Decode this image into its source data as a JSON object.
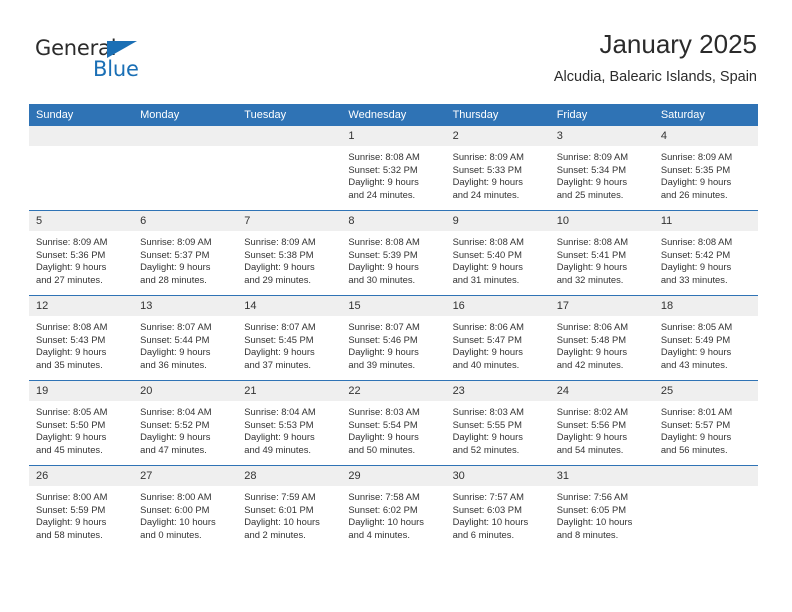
{
  "brand": {
    "name_part1": "General",
    "name_part2": "Blue",
    "accent_color": "#1a6fb5"
  },
  "header": {
    "title": "January 2025",
    "subtitle": "Alcudia, Balearic Islands, Spain"
  },
  "theme": {
    "header_row_color": "#2f73b5",
    "daynum_band_color": "#efefef",
    "text_color": "#333333"
  },
  "weekdays": [
    "Sunday",
    "Monday",
    "Tuesday",
    "Wednesday",
    "Thursday",
    "Friday",
    "Saturday"
  ],
  "weeks": [
    [
      {
        "day": "",
        "empty": true
      },
      {
        "day": "",
        "empty": true
      },
      {
        "day": "",
        "empty": true
      },
      {
        "day": "1",
        "sunrise": "Sunrise: 8:08 AM",
        "sunset": "Sunset: 5:32 PM",
        "daylight1": "Daylight: 9 hours",
        "daylight2": "and 24 minutes."
      },
      {
        "day": "2",
        "sunrise": "Sunrise: 8:09 AM",
        "sunset": "Sunset: 5:33 PM",
        "daylight1": "Daylight: 9 hours",
        "daylight2": "and 24 minutes."
      },
      {
        "day": "3",
        "sunrise": "Sunrise: 8:09 AM",
        "sunset": "Sunset: 5:34 PM",
        "daylight1": "Daylight: 9 hours",
        "daylight2": "and 25 minutes."
      },
      {
        "day": "4",
        "sunrise": "Sunrise: 8:09 AM",
        "sunset": "Sunset: 5:35 PM",
        "daylight1": "Daylight: 9 hours",
        "daylight2": "and 26 minutes."
      }
    ],
    [
      {
        "day": "5",
        "sunrise": "Sunrise: 8:09 AM",
        "sunset": "Sunset: 5:36 PM",
        "daylight1": "Daylight: 9 hours",
        "daylight2": "and 27 minutes."
      },
      {
        "day": "6",
        "sunrise": "Sunrise: 8:09 AM",
        "sunset": "Sunset: 5:37 PM",
        "daylight1": "Daylight: 9 hours",
        "daylight2": "and 28 minutes."
      },
      {
        "day": "7",
        "sunrise": "Sunrise: 8:09 AM",
        "sunset": "Sunset: 5:38 PM",
        "daylight1": "Daylight: 9 hours",
        "daylight2": "and 29 minutes."
      },
      {
        "day": "8",
        "sunrise": "Sunrise: 8:08 AM",
        "sunset": "Sunset: 5:39 PM",
        "daylight1": "Daylight: 9 hours",
        "daylight2": "and 30 minutes."
      },
      {
        "day": "9",
        "sunrise": "Sunrise: 8:08 AM",
        "sunset": "Sunset: 5:40 PM",
        "daylight1": "Daylight: 9 hours",
        "daylight2": "and 31 minutes."
      },
      {
        "day": "10",
        "sunrise": "Sunrise: 8:08 AM",
        "sunset": "Sunset: 5:41 PM",
        "daylight1": "Daylight: 9 hours",
        "daylight2": "and 32 minutes."
      },
      {
        "day": "11",
        "sunrise": "Sunrise: 8:08 AM",
        "sunset": "Sunset: 5:42 PM",
        "daylight1": "Daylight: 9 hours",
        "daylight2": "and 33 minutes."
      }
    ],
    [
      {
        "day": "12",
        "sunrise": "Sunrise: 8:08 AM",
        "sunset": "Sunset: 5:43 PM",
        "daylight1": "Daylight: 9 hours",
        "daylight2": "and 35 minutes."
      },
      {
        "day": "13",
        "sunrise": "Sunrise: 8:07 AM",
        "sunset": "Sunset: 5:44 PM",
        "daylight1": "Daylight: 9 hours",
        "daylight2": "and 36 minutes."
      },
      {
        "day": "14",
        "sunrise": "Sunrise: 8:07 AM",
        "sunset": "Sunset: 5:45 PM",
        "daylight1": "Daylight: 9 hours",
        "daylight2": "and 37 minutes."
      },
      {
        "day": "15",
        "sunrise": "Sunrise: 8:07 AM",
        "sunset": "Sunset: 5:46 PM",
        "daylight1": "Daylight: 9 hours",
        "daylight2": "and 39 minutes."
      },
      {
        "day": "16",
        "sunrise": "Sunrise: 8:06 AM",
        "sunset": "Sunset: 5:47 PM",
        "daylight1": "Daylight: 9 hours",
        "daylight2": "and 40 minutes."
      },
      {
        "day": "17",
        "sunrise": "Sunrise: 8:06 AM",
        "sunset": "Sunset: 5:48 PM",
        "daylight1": "Daylight: 9 hours",
        "daylight2": "and 42 minutes."
      },
      {
        "day": "18",
        "sunrise": "Sunrise: 8:05 AM",
        "sunset": "Sunset: 5:49 PM",
        "daylight1": "Daylight: 9 hours",
        "daylight2": "and 43 minutes."
      }
    ],
    [
      {
        "day": "19",
        "sunrise": "Sunrise: 8:05 AM",
        "sunset": "Sunset: 5:50 PM",
        "daylight1": "Daylight: 9 hours",
        "daylight2": "and 45 minutes."
      },
      {
        "day": "20",
        "sunrise": "Sunrise: 8:04 AM",
        "sunset": "Sunset: 5:52 PM",
        "daylight1": "Daylight: 9 hours",
        "daylight2": "and 47 minutes."
      },
      {
        "day": "21",
        "sunrise": "Sunrise: 8:04 AM",
        "sunset": "Sunset: 5:53 PM",
        "daylight1": "Daylight: 9 hours",
        "daylight2": "and 49 minutes."
      },
      {
        "day": "22",
        "sunrise": "Sunrise: 8:03 AM",
        "sunset": "Sunset: 5:54 PM",
        "daylight1": "Daylight: 9 hours",
        "daylight2": "and 50 minutes."
      },
      {
        "day": "23",
        "sunrise": "Sunrise: 8:03 AM",
        "sunset": "Sunset: 5:55 PM",
        "daylight1": "Daylight: 9 hours",
        "daylight2": "and 52 minutes."
      },
      {
        "day": "24",
        "sunrise": "Sunrise: 8:02 AM",
        "sunset": "Sunset: 5:56 PM",
        "daylight1": "Daylight: 9 hours",
        "daylight2": "and 54 minutes."
      },
      {
        "day": "25",
        "sunrise": "Sunrise: 8:01 AM",
        "sunset": "Sunset: 5:57 PM",
        "daylight1": "Daylight: 9 hours",
        "daylight2": "and 56 minutes."
      }
    ],
    [
      {
        "day": "26",
        "sunrise": "Sunrise: 8:00 AM",
        "sunset": "Sunset: 5:59 PM",
        "daylight1": "Daylight: 9 hours",
        "daylight2": "and 58 minutes."
      },
      {
        "day": "27",
        "sunrise": "Sunrise: 8:00 AM",
        "sunset": "Sunset: 6:00 PM",
        "daylight1": "Daylight: 10 hours",
        "daylight2": "and 0 minutes."
      },
      {
        "day": "28",
        "sunrise": "Sunrise: 7:59 AM",
        "sunset": "Sunset: 6:01 PM",
        "daylight1": "Daylight: 10 hours",
        "daylight2": "and 2 minutes."
      },
      {
        "day": "29",
        "sunrise": "Sunrise: 7:58 AM",
        "sunset": "Sunset: 6:02 PM",
        "daylight1": "Daylight: 10 hours",
        "daylight2": "and 4 minutes."
      },
      {
        "day": "30",
        "sunrise": "Sunrise: 7:57 AM",
        "sunset": "Sunset: 6:03 PM",
        "daylight1": "Daylight: 10 hours",
        "daylight2": "and 6 minutes."
      },
      {
        "day": "31",
        "sunrise": "Sunrise: 7:56 AM",
        "sunset": "Sunset: 6:05 PM",
        "daylight1": "Daylight: 10 hours",
        "daylight2": "and 8 minutes."
      },
      {
        "day": "",
        "empty": true
      }
    ]
  ]
}
